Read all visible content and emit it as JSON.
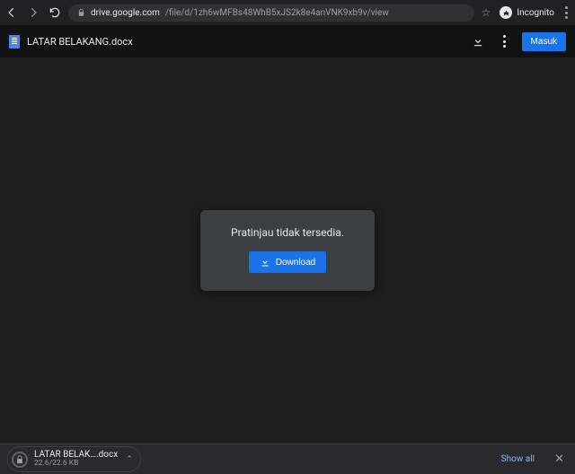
{
  "browser": {
    "url_host": "drive.google.com",
    "url_path": "/file/d/1zh6wMFBs48WhB5xJS2k8e4anVNK9xb9v/view",
    "incognito_label": "Incognito"
  },
  "drive": {
    "filename": "LATAR BELAKANG.docx",
    "signin_label": "Masuk"
  },
  "preview": {
    "message": "Pratinjau tidak tersedia.",
    "download_label": "Download"
  },
  "shelf": {
    "filename": "LATAR BELAK….docx",
    "size": "22.6/22.6 KB",
    "show_all": "Show all"
  }
}
